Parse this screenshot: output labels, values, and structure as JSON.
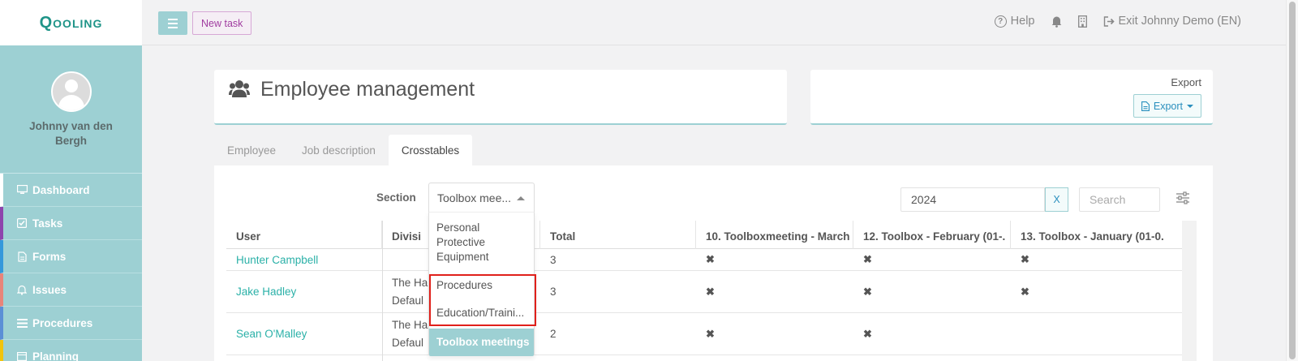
{
  "app": {
    "logo_text": "Qooling"
  },
  "user": {
    "name": "Johnny van den Bergh"
  },
  "sidebar": {
    "items": [
      {
        "label": "Dashboard",
        "icon": "monitor-icon",
        "accent": "#ffffff"
      },
      {
        "label": "Tasks",
        "icon": "check-square-icon",
        "accent": "#8e44ad"
      },
      {
        "label": "Forms",
        "icon": "file-icon",
        "accent": "#3498db"
      },
      {
        "label": "Issues",
        "icon": "bell-icon",
        "accent": "#e8847a"
      },
      {
        "label": "Procedures",
        "icon": "list-icon",
        "accent": "#5b8fd6"
      },
      {
        "label": "Planning",
        "icon": "calendar-icon",
        "accent": "#f1c40f"
      }
    ]
  },
  "topbar": {
    "new_task_label": "New task",
    "help_label": "Help",
    "exit_label": "Exit Johnny Demo (EN)"
  },
  "page": {
    "title": "Employee management",
    "export_heading": "Export",
    "export_button": "Export"
  },
  "tabs": [
    {
      "label": "Employee",
      "active": false
    },
    {
      "label": "Job description",
      "active": false
    },
    {
      "label": "Crosstables",
      "active": true
    }
  ],
  "filters": {
    "section_label": "Section",
    "section_value": "Toolbox mee...",
    "year_value": "2024",
    "clear_label": "X",
    "search_placeholder": "Search"
  },
  "dropdown": {
    "options": [
      {
        "label": "Personal Protective Equipment",
        "selected": false
      },
      {
        "label": "Procedures",
        "selected": false
      },
      {
        "label": "Education/Traini...",
        "selected": false
      },
      {
        "label": "Toolbox meetings",
        "selected": true
      }
    ]
  },
  "table": {
    "columns": [
      "User",
      "Divisi",
      "Total",
      "10. Toolboxmeeting - March",
      "12. Toolbox - February (01-.",
      "13. Toolbox - January (01-0."
    ],
    "rows": [
      {
        "user": "Hunter Campbell",
        "division1": "",
        "division2": "",
        "total": "3",
        "c10": "✖",
        "c12": "✖",
        "c13": "✖"
      },
      {
        "user": "Jake Hadley",
        "division1": "The Ha",
        "division2": "Defaul",
        "total": "3",
        "c10": "✖",
        "c12": "✖",
        "c13": "✖"
      },
      {
        "user": "Sean O'Malley",
        "division1": "The Ha",
        "division2": "Defaul",
        "total": "2",
        "c10": "✖",
        "c12": "✖",
        "c13": ""
      }
    ]
  },
  "colors": {
    "accent": "#9dd0d3",
    "link": "#2bb1a8",
    "logo": "#1f9488",
    "highlight": "#e0201b"
  }
}
